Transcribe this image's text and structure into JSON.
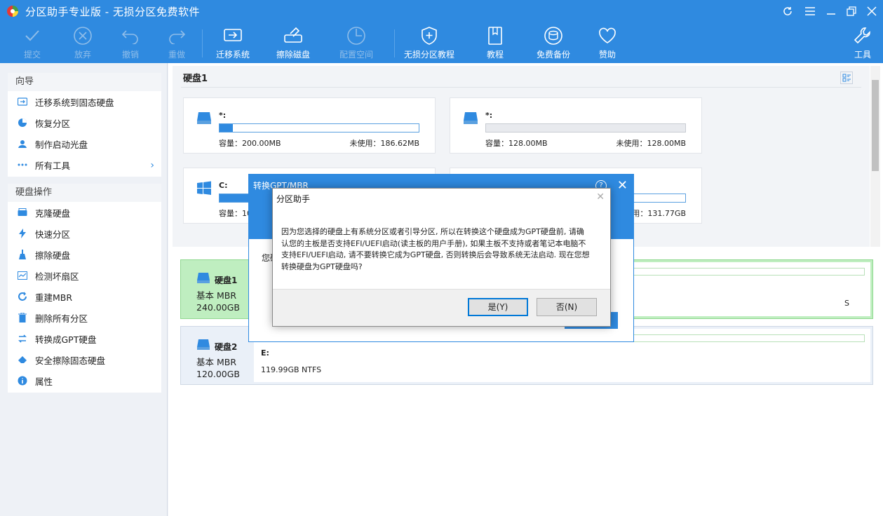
{
  "app": {
    "title": "分区助手专业版 - 无损分区免费软件"
  },
  "toolbar": {
    "submit": "提交",
    "discard": "放弃",
    "undo": "撤销",
    "redo": "重做",
    "migrate_os": "迁移系统",
    "wipe_disk": "擦除磁盘",
    "allocate_space": "配置空间",
    "tutorial_lossless": "无损分区教程",
    "tutorial": "教程",
    "free_backup": "免费备份",
    "sponsor": "赞助",
    "tools": "工具"
  },
  "sidebar": {
    "wizard_title": "向导",
    "wizard_items": [
      {
        "label": "迁移系统到固态硬盘",
        "icon": "migrate-icon"
      },
      {
        "label": "恢复分区",
        "icon": "recover-icon"
      },
      {
        "label": "制作启动光盘",
        "icon": "bootdisk-icon"
      },
      {
        "label": "所有工具",
        "icon": "grid-icon"
      }
    ],
    "disk_ops_title": "硬盘操作",
    "disk_ops_items": [
      {
        "label": "克隆硬盘",
        "icon": "clone-icon"
      },
      {
        "label": "快速分区",
        "icon": "lightning-icon"
      },
      {
        "label": "擦除硬盘",
        "icon": "broom-icon"
      },
      {
        "label": "检测坏扇区",
        "icon": "scan-icon"
      },
      {
        "label": "重建MBR",
        "icon": "rebuild-icon"
      },
      {
        "label": "删除所有分区",
        "icon": "trash-icon"
      },
      {
        "label": "转换成GPT硬盘",
        "icon": "convert-icon"
      },
      {
        "label": "安全擦除固态硬盘",
        "icon": "eraser-icon"
      },
      {
        "label": "属性",
        "icon": "info-icon"
      }
    ]
  },
  "disk_view": {
    "title": "硬盘1",
    "partitions": [
      {
        "name": "*:",
        "capacity": "容量：200.00MB",
        "unused": "未使用：186.62MB",
        "used_fraction": 0.067
      },
      {
        "name": "*:",
        "capacity": "容量：128.00MB",
        "unused": "未使用：128.00MB",
        "used_fraction": 0
      },
      {
        "name": "C:",
        "capacity": "容量：10",
        "unused": "",
        "used_fraction": 0.5
      },
      {
        "name": "",
        "capacity": "",
        "unused": "使用：131.77GB",
        "used_fraction": 0
      }
    ]
  },
  "disks": [
    {
      "name": "硬盘1",
      "type": "基本 MBR",
      "size": "240.00GB",
      "part_label": "",
      "part_info": "S"
    },
    {
      "name": "硬盘2",
      "type": "基本 MBR",
      "size": "120.00GB",
      "part_label": "E:",
      "part_info": "119.99GB NTFS"
    }
  ],
  "bg_dialog": {
    "title": "转换GPT/MBR",
    "text": "您确"
  },
  "msgbox": {
    "title": "分区助手",
    "message": "因为您选择的硬盘上有系统分区或者引导分区, 所以在转换这个硬盘成为GPT硬盘前, 请确认您的主板是否支持EFI/UEFI启动(读主板的用户手册), 如果主板不支持或者笔记本电脑不支持EFI/UEFI启动, 请不要转换它成为GPT硬盘, 否则转换后会导致系统无法启动. 现在您想转换硬盘为GPT硬盘吗?",
    "yes": "是(Y)",
    "no": "否(N)"
  },
  "colors": {
    "accent": "#2f8ae0",
    "selected_row": "#bfeec0"
  }
}
